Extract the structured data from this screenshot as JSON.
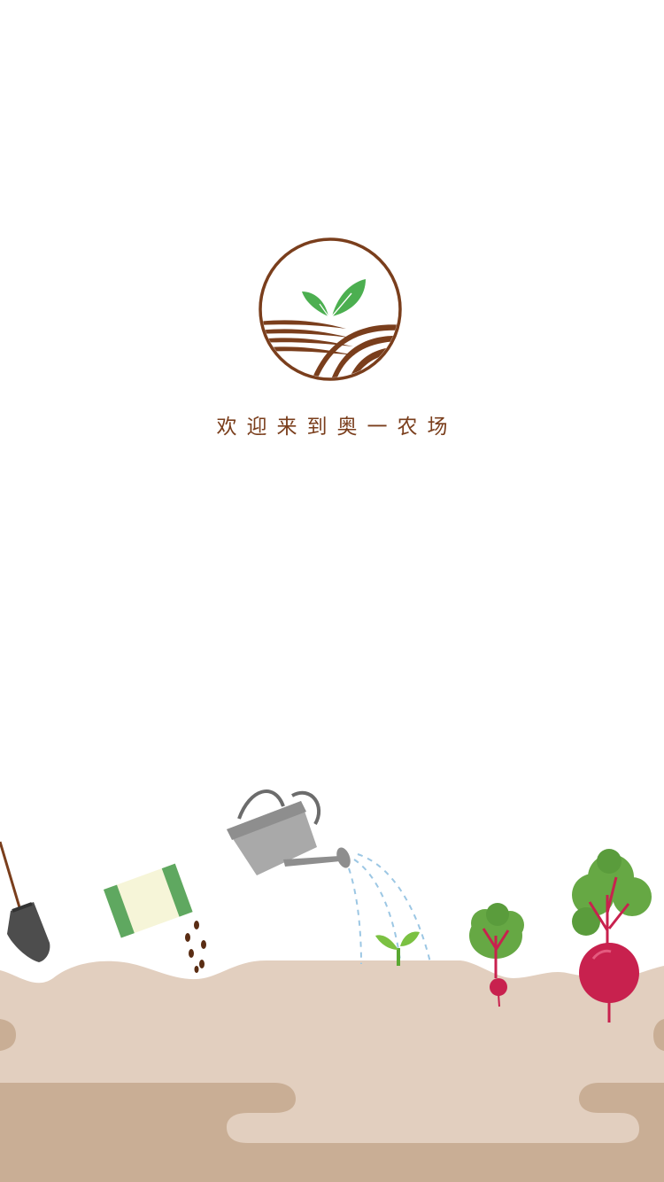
{
  "welcome": {
    "text": "欢迎来到奥一农场"
  },
  "logo": {
    "icon": "farm-sprout-logo",
    "ring_color": "#7a3e1c",
    "leaf_color": "#4caf50"
  },
  "scene": {
    "soil_color": "#e2cfbf",
    "soil_dark_color": "#c9ae95",
    "illustrations": [
      "shovel-icon",
      "seed-packet-icon",
      "watering-can-icon",
      "seedling-icon",
      "radish-icon",
      "beet-icon"
    ]
  }
}
